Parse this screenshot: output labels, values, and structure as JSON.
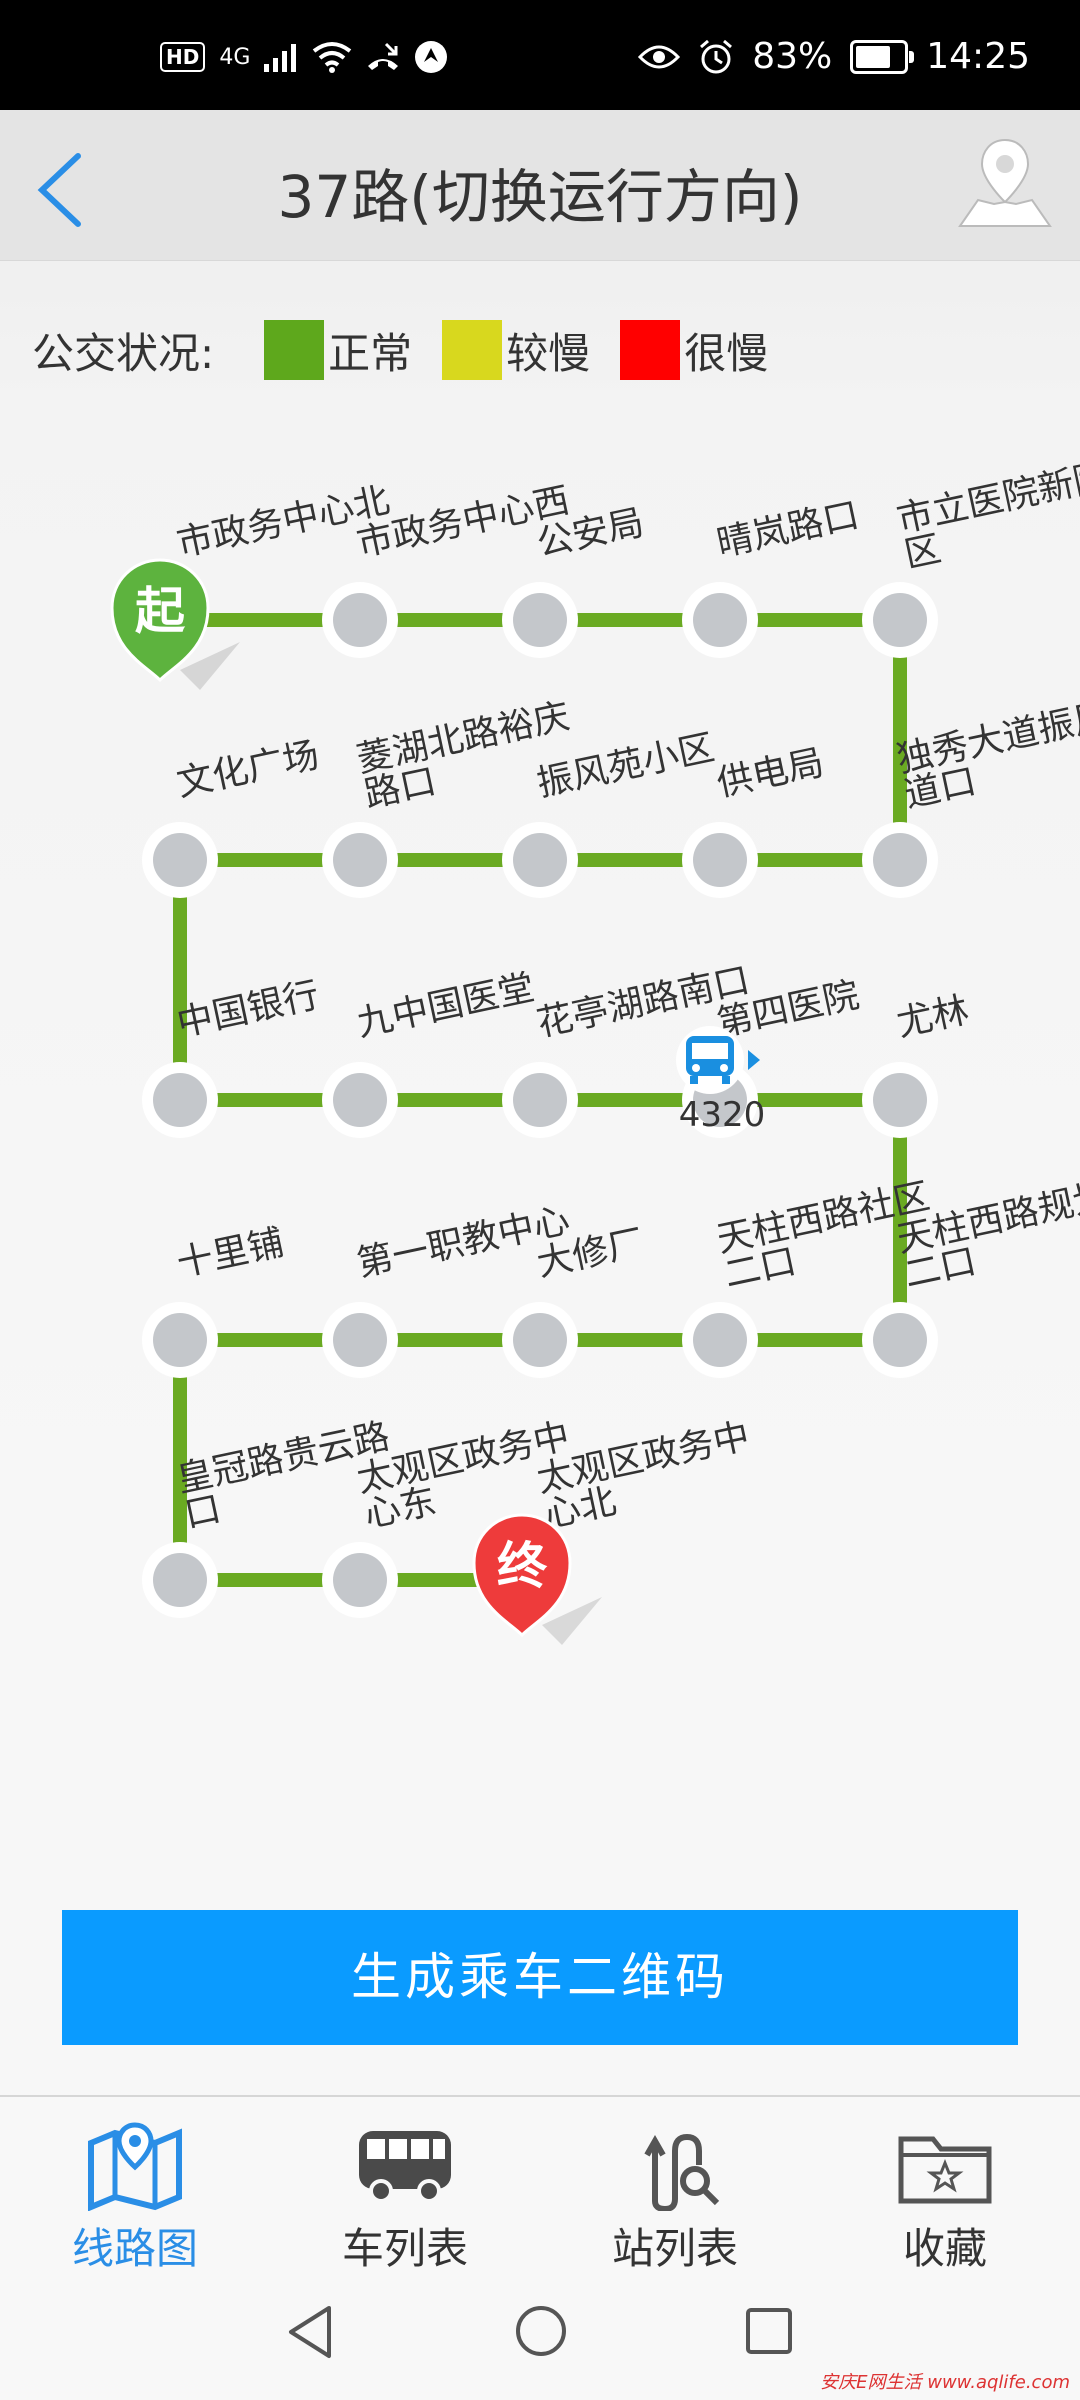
{
  "status_bar": {
    "badge": "HD",
    "network": "4G",
    "battery": "83%",
    "time": "14:25",
    "icons": [
      "signal-icon",
      "wifi-icon",
      "call-icon",
      "app-icon",
      "eye-icon",
      "alarm-icon",
      "battery-icon"
    ]
  },
  "header": {
    "title": "37路(切换运行方向)",
    "back_icon": "chevron-left-icon",
    "map_icon": "map-pin-icon"
  },
  "legend": {
    "caption": "公交状况:",
    "items": [
      {
        "label": "正常",
        "color": "#5ea81c"
      },
      {
        "label": "较慢",
        "color": "#d8d81e"
      },
      {
        "label": "很慢",
        "color": "#ff0000"
      }
    ]
  },
  "route": {
    "start_marker": "起",
    "end_marker": "终",
    "line_color": "#6aaa22",
    "stops": [
      {
        "name": "市政务中心北"
      },
      {
        "name": "市政务中心西"
      },
      {
        "name": "公安局"
      },
      {
        "name": "晴岚路口"
      },
      {
        "name": "市立医院新院区"
      },
      {
        "name": "独秀大道振风道口"
      },
      {
        "name": "供电局"
      },
      {
        "name": "振风苑小区"
      },
      {
        "name": "菱湖北路裕庆路口"
      },
      {
        "name": "文化广场"
      },
      {
        "name": "中国银行"
      },
      {
        "name": "九中国医堂"
      },
      {
        "name": "花亭湖路南口"
      },
      {
        "name": "第四医院"
      },
      {
        "name": "尤林"
      },
      {
        "name": "天柱西路规划二口"
      },
      {
        "name": "天柱西路社区二口"
      },
      {
        "name": "大修厂"
      },
      {
        "name": "第一职教中心"
      },
      {
        "name": "十里铺"
      },
      {
        "name": "皇冠路贵云路口"
      },
      {
        "name": "太观区政务中心东"
      },
      {
        "name": "太观区政务中心北"
      }
    ],
    "bus": {
      "number": "4320",
      "icon": "bus-icon"
    }
  },
  "qr_button": {
    "label": "生成乘车二维码"
  },
  "tabs": [
    {
      "label": "线路图",
      "icon": "route-map-icon",
      "active": true
    },
    {
      "label": "车列表",
      "icon": "bus-list-icon",
      "active": false
    },
    {
      "label": "站列表",
      "icon": "station-search-icon",
      "active": false
    },
    {
      "label": "收藏",
      "icon": "favorite-folder-icon",
      "active": false
    }
  ],
  "nav": {
    "back": "back-triangle-icon",
    "home": "home-circle-icon",
    "recents": "recents-square-icon"
  },
  "watermark": "安庆E网生活 www.aqlife.com"
}
